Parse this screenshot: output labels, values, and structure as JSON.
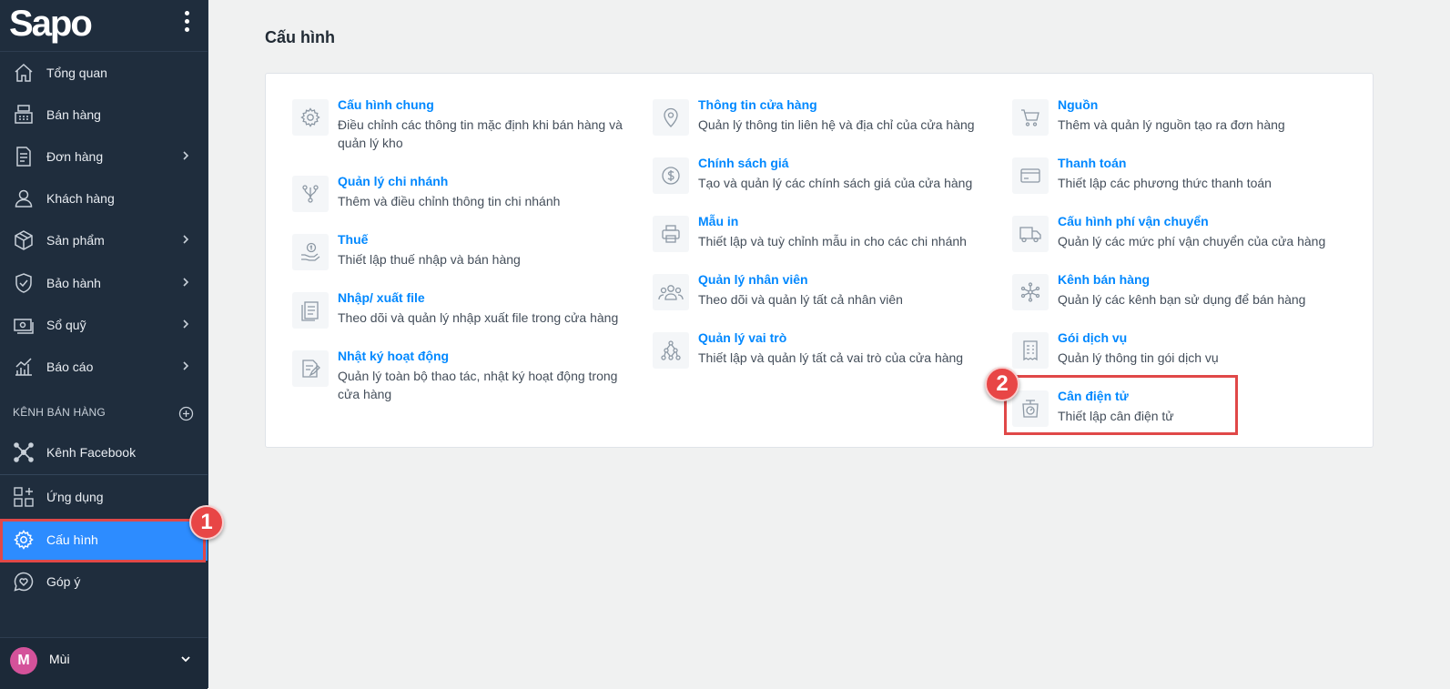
{
  "brand": {
    "logo_text": "Sapo"
  },
  "sidebar": {
    "items": [
      {
        "label": "Tổng quan",
        "icon": "home-icon"
      },
      {
        "label": "Bán hàng",
        "icon": "pos-register-icon"
      },
      {
        "label": "Đơn hàng",
        "icon": "order-document-icon",
        "has_submenu": true
      },
      {
        "label": "Khách hàng",
        "icon": "user-icon"
      },
      {
        "label": "Sản phẩm",
        "icon": "box-icon",
        "has_submenu": true
      },
      {
        "label": "Bảo hành",
        "icon": "shield-check-icon",
        "has_submenu": true
      },
      {
        "label": "Sổ quỹ",
        "icon": "cash-book-icon",
        "has_submenu": true
      },
      {
        "label": "Báo cáo",
        "icon": "chart-icon",
        "has_submenu": true
      }
    ],
    "channels_section_label": "KÊNH BÁN HÀNG",
    "channel_items": [
      {
        "label": "Kênh Facebook",
        "icon": "network-nodes-icon"
      }
    ],
    "bottom_items": [
      {
        "label": "Ứng dụng",
        "icon": "apps-grid-icon"
      },
      {
        "label": "Cấu hình",
        "icon": "gear-icon",
        "active": true
      },
      {
        "label": "Góp ý",
        "icon": "feedback-heart-icon"
      }
    ],
    "user": {
      "avatar_letter": "M",
      "name": "Mùi"
    }
  },
  "annotations": {
    "step1": "1",
    "step2": "2"
  },
  "main": {
    "title": "Cấu hình",
    "columns": [
      [
        {
          "title": "Cấu hình chung",
          "desc": "Điều chỉnh các thông tin mặc định khi bán hàng và quản lý kho",
          "icon": "gear-icon"
        },
        {
          "title": "Quản lý chi nhánh",
          "desc": "Thêm và điều chỉnh thông tin chi nhánh",
          "icon": "branch-icon"
        },
        {
          "title": "Thuế",
          "desc": "Thiết lập thuế nhập và bán hàng",
          "icon": "tax-hand-icon"
        },
        {
          "title": "Nhập/ xuất file",
          "desc": "Theo dõi và quản lý nhập xuất file trong cửa hàng",
          "icon": "file-stack-icon"
        },
        {
          "title": "Nhật ký hoạt động",
          "desc": "Quản lý toàn bộ thao tác, nhật ký hoạt động trong cửa hàng",
          "icon": "activity-log-icon"
        }
      ],
      [
        {
          "title": "Thông tin cửa hàng",
          "desc": "Quản lý thông tin liên hệ và địa chỉ của cửa hàng",
          "icon": "map-pin-icon"
        },
        {
          "title": "Chính sách giá",
          "desc": "Tạo và quản lý các chính sách giá của cửa hàng",
          "icon": "dollar-circle-icon"
        },
        {
          "title": "Mẫu in",
          "desc": "Thiết lập và tuỳ chỉnh mẫu in cho các chi nhánh",
          "icon": "printer-icon"
        },
        {
          "title": "Quản lý nhân viên",
          "desc": "Theo dõi và quản lý tất cả nhân viên",
          "icon": "staff-group-icon"
        },
        {
          "title": "Quản lý vai trò",
          "desc": "Thiết lập và quản lý tất cả vai trò của cửa hàng",
          "icon": "role-hierarchy-icon"
        }
      ],
      [
        {
          "title": "Nguồn",
          "desc": "Thêm và quản lý nguồn tạo ra đơn hàng",
          "icon": "cart-icon"
        },
        {
          "title": "Thanh toán",
          "desc": "Thiết lập các phương thức thanh toán",
          "icon": "credit-card-icon"
        },
        {
          "title": "Cấu hình phí vận chuyển",
          "desc": "Quản lý các mức phí vận chuyển của cửa hàng",
          "icon": "truck-icon"
        },
        {
          "title": "Kênh bán hàng",
          "desc": "Quản lý các kênh bạn sử dụng để bán hàng",
          "icon": "channels-network-icon"
        },
        {
          "title": "Gói dịch vụ",
          "desc": "Quản lý thông tin gói dịch vụ",
          "icon": "service-receipt-icon"
        },
        {
          "title": "Cân điện tử",
          "desc": "Thiết lập cân điện tử",
          "icon": "scale-icon"
        }
      ]
    ]
  }
}
